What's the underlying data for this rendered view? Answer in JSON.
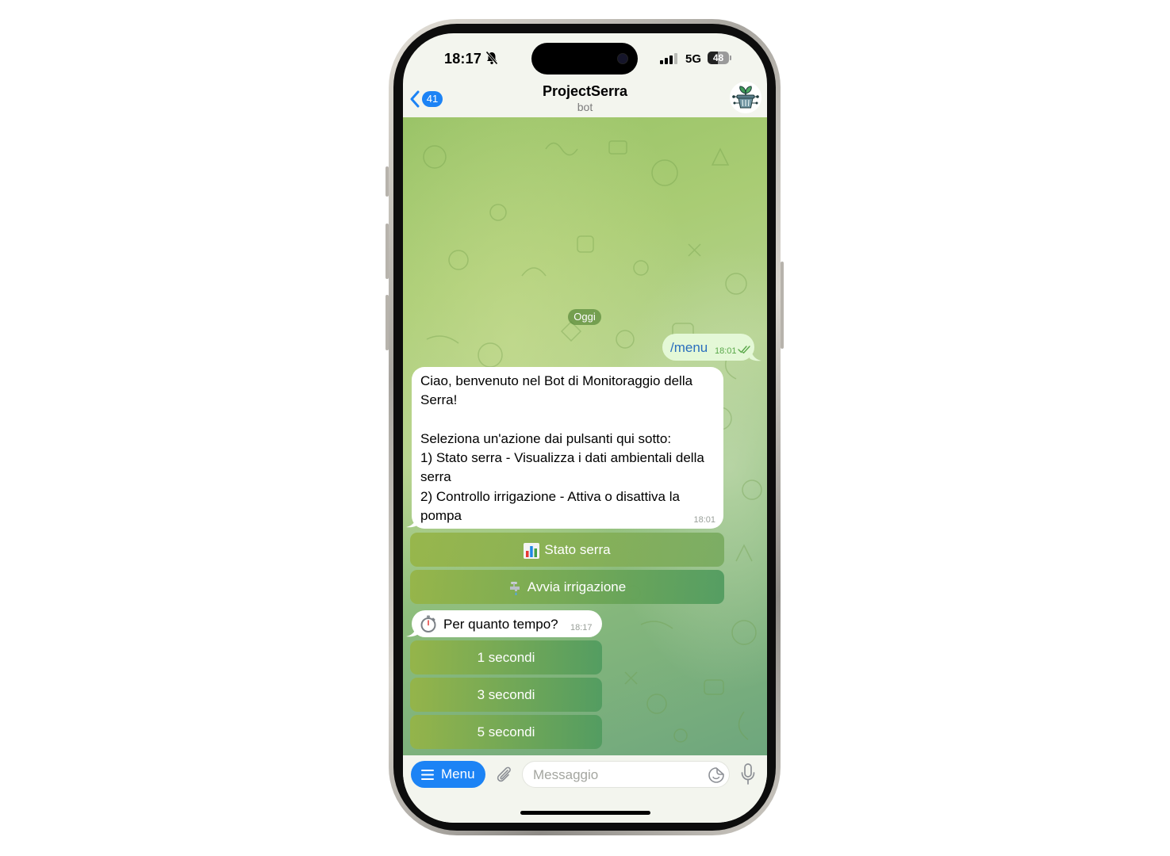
{
  "status_bar": {
    "time": "18:17",
    "network": "5G",
    "battery": "48",
    "battery_level": 0.48
  },
  "header": {
    "back_badge": "41",
    "title": "ProjectSerra",
    "subtitle": "bot"
  },
  "chat": {
    "date_divider": "Oggi",
    "messages": [
      {
        "direction": "outgoing",
        "text": "/menu",
        "time": "18:01",
        "status": "read"
      },
      {
        "direction": "incoming",
        "text": "Ciao, benvenuto nel Bot di Monitoraggio della Serra!\n\nSeleziona un'azione dai pulsanti qui sotto:\n1) Stato serra - Visualizza i dati ambientali della serra\n2) Controllo irrigazione - Attiva o disattiva la pompa",
        "time": "18:01"
      },
      {
        "direction": "incoming",
        "text": "Per quanto tempo?",
        "time": "18:17",
        "icon": "stopwatch-icon"
      }
    ],
    "keyboard_1": [
      {
        "label": "Stato serra",
        "icon": "bar-chart-icon"
      },
      {
        "label": "Avvia irrigazione",
        "icon": "faucet-icon"
      }
    ],
    "keyboard_2": [
      {
        "label": "1 secondi"
      },
      {
        "label": "3 secondi"
      },
      {
        "label": "5 secondi"
      }
    ]
  },
  "input_bar": {
    "menu_label": "Menu",
    "placeholder": "Messaggio"
  },
  "colors": {
    "accent": "#1c83f5",
    "outgoing_bubble": "#e4f8d7",
    "incoming_bubble": "#ffffff",
    "chat_background": "#a9cc74"
  }
}
